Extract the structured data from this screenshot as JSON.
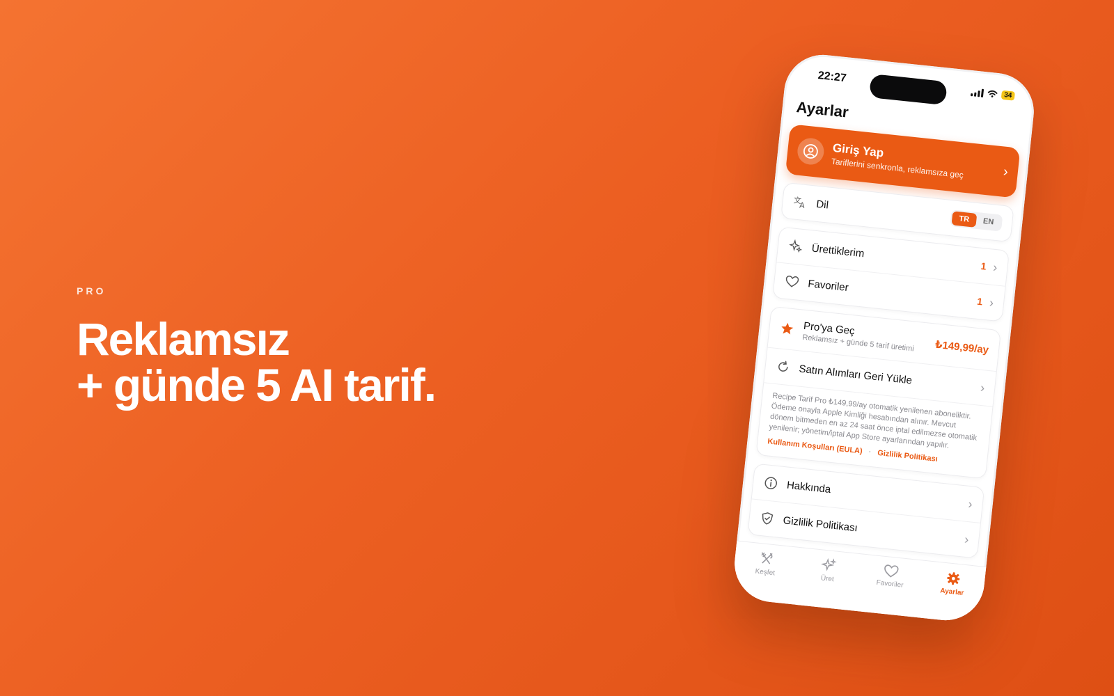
{
  "hero": {
    "eyebrow": "PRO",
    "headline_line1": "Reklamsız",
    "headline_line2": "+ günde 5 AI tarif."
  },
  "status_bar": {
    "time": "22:27",
    "battery": "34"
  },
  "settings": {
    "title": "Ayarlar",
    "login": {
      "title": "Giriş Yap",
      "subtitle": "Tariflerini senkronla, reklamsıza geç"
    },
    "language": {
      "label": "Dil",
      "options": [
        "TR",
        "EN"
      ],
      "selected": "TR"
    },
    "list": {
      "generated_label": "Ürettiklerim",
      "generated_count": "1",
      "favorites_label": "Favoriler",
      "favorites_count": "1"
    },
    "pro": {
      "title": "Pro'ya Geç",
      "subtitle": "Reklamsız + günde 5 tarif üretimi",
      "price": "₺149,99/ay",
      "restore_label": "Satın Alımları Geri Yükle",
      "legal_text": "Recipe Tarif Pro ₺149,99/ay otomatik yenilenen aboneliktir. Ödeme onayla Apple Kimliği hesabından alınır. Mevcut dönem bitmeden en az 24 saat önce iptal edilmezse otomatik yenilenir; yönetim/iptal App Store ayarlarından yapılır.",
      "eula_link": "Kullanım Koşulları (EULA)",
      "separator": "·",
      "privacy_link": "Gizlilik Politikası"
    },
    "about": {
      "about_label": "Hakkında",
      "privacy_label": "Gizlilik Politikası"
    }
  },
  "tabbar": {
    "tabs": [
      "Keşfet",
      "Üret",
      "Favoriler",
      "Ayarlar"
    ],
    "active": "Ayarlar"
  },
  "colors": {
    "accent": "#ea5a14",
    "background_start": "#f47331",
    "background_end": "#de4f14"
  }
}
